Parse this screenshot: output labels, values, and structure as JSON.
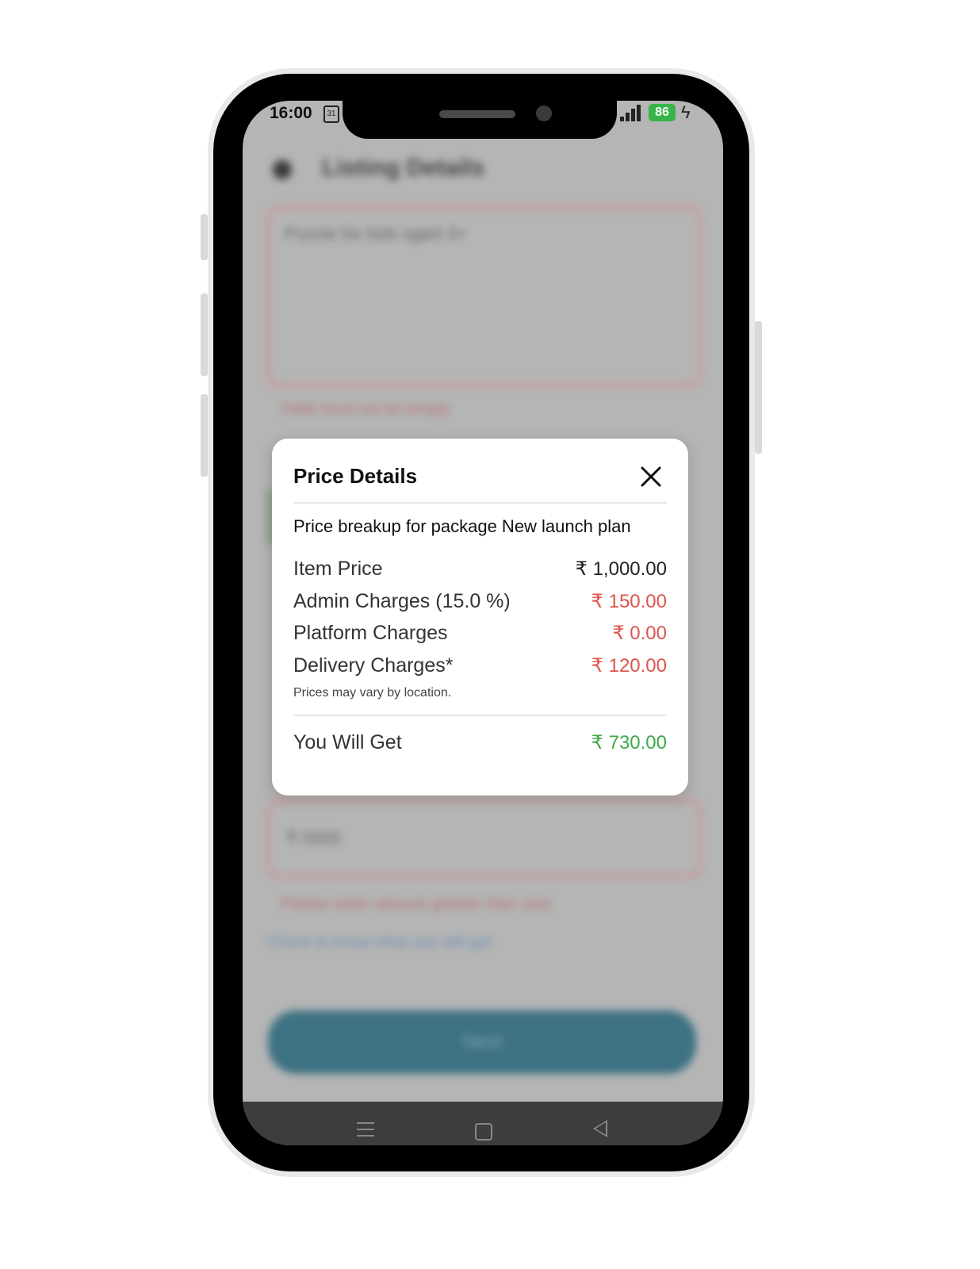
{
  "status_bar": {
    "time": "16:00",
    "calendar_day": "31",
    "battery": "86"
  },
  "background": {
    "screen_title": "Listing Details",
    "description_text": "Puzzle for kids aged 3+",
    "description_error": "Field must not be empty",
    "price_value": "₹ 0000",
    "price_error": "Please enter amount greater than zero",
    "check_link": "Check to know what you will get",
    "next_label": "Next"
  },
  "modal": {
    "title": "Price Details",
    "subtitle": "Price breakup for package New launch plan",
    "rows": [
      {
        "label": "Item Price",
        "value": "₹ 1,000.00",
        "color": "#222222"
      },
      {
        "label": "Admin Charges (15.0 %)",
        "value": "₹ 150.00",
        "color": "#e0534d"
      },
      {
        "label": "Platform Charges",
        "value": "₹ 0.00",
        "color": "#e0534d"
      },
      {
        "label": "Delivery Charges*",
        "value": "₹ 120.00",
        "color": "#e0534d"
      }
    ],
    "note": "Prices may vary by location.",
    "total": {
      "label": "You Will Get",
      "value": "₹ 730.00",
      "color": "#3fa94a"
    }
  }
}
